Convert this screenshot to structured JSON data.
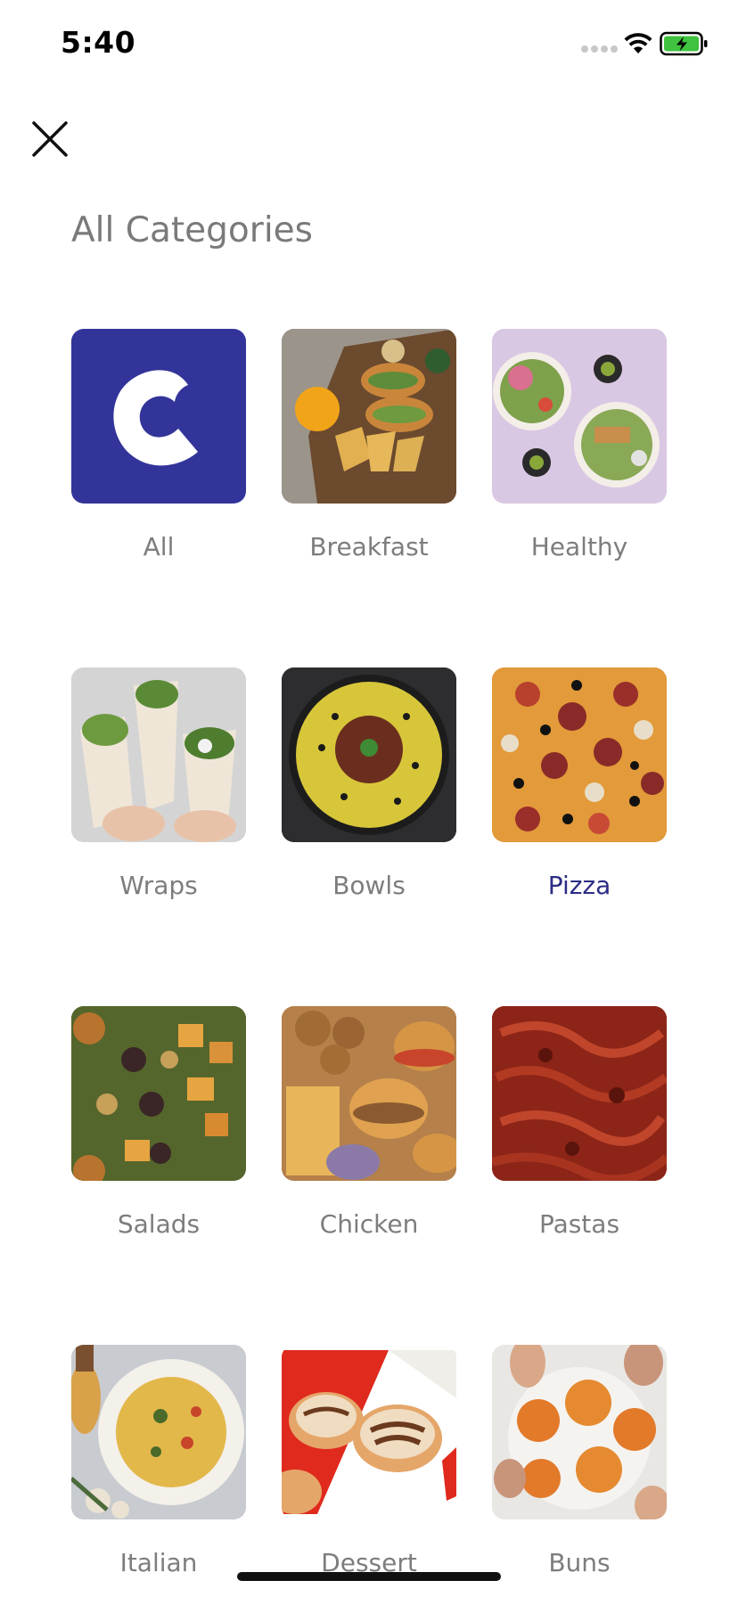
{
  "status_bar": {
    "time": "5:40"
  },
  "header": {
    "title": "All Categories"
  },
  "categories": [
    {
      "label": "All",
      "image": "brand-logo",
      "selected": false
    },
    {
      "label": "Breakfast",
      "image": "breakfast-photo",
      "selected": false
    },
    {
      "label": "Healthy",
      "image": "healthy-bowls-photo",
      "selected": false
    },
    {
      "label": "Wraps",
      "image": "wraps-photo",
      "selected": false
    },
    {
      "label": "Bowls",
      "image": "rice-bowl-photo",
      "selected": false
    },
    {
      "label": "Pizza",
      "image": "pizza-photo",
      "selected": true
    },
    {
      "label": "Salads",
      "image": "salad-photo",
      "selected": false
    },
    {
      "label": "Chicken",
      "image": "chicken-burger-photo",
      "selected": false
    },
    {
      "label": "Pastas",
      "image": "pasta-photo",
      "selected": false
    },
    {
      "label": "Italian",
      "image": "italian-plate-photo",
      "selected": false
    },
    {
      "label": "Dessert",
      "image": "dessert-tarts-photo",
      "selected": false
    },
    {
      "label": "Buns",
      "image": "buns-photo",
      "selected": false
    }
  ],
  "colors": {
    "brand": "#33349a",
    "selected_label": "#2c2d85",
    "label": "#7d7d7d",
    "title": "#7a7a7a",
    "battery": "#3fc23f"
  }
}
